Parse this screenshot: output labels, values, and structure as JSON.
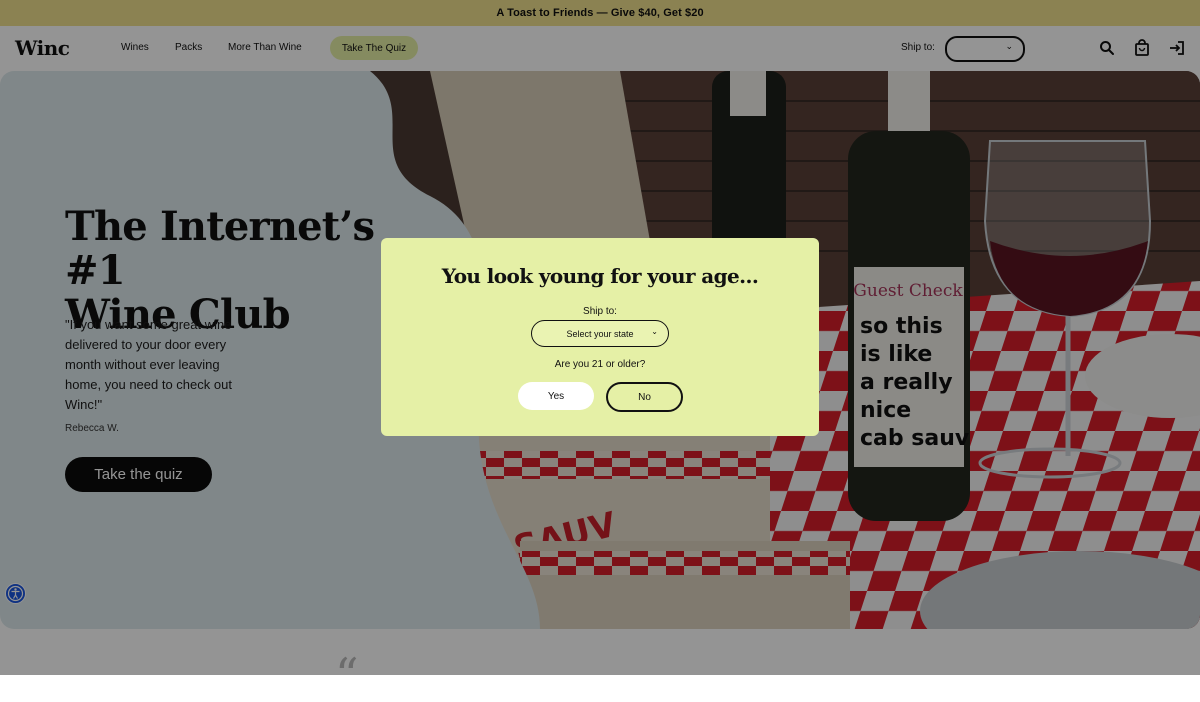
{
  "promo": {
    "text": "A Toast to Friends — Give $40, Get $20"
  },
  "header": {
    "logo": "Winc",
    "nav": [
      "Wines",
      "Packs",
      "More Than Wine"
    ],
    "quiz_label": "Take The Quiz",
    "ship_to_label": "Ship to:",
    "ship_to_value": "",
    "icons": [
      "search-icon",
      "bag-icon",
      "sign-in-icon"
    ]
  },
  "hero": {
    "title_line1": "The Internet’s #1",
    "title_line2": "Wine Club",
    "quote": "\"If you want some great wine delivered to your door every month without ever leaving home, you need to check out Winc!\"",
    "author": "Rebecca W.",
    "cta": "Take the quiz",
    "bottle_label_brand": "Guest Check",
    "bottle_label_text": [
      "so this",
      "is like",
      "a really",
      "nice",
      "cab sauv"
    ],
    "box_text": "-SAUV"
  },
  "modal": {
    "title": "You look young for your age...",
    "ship_label": "Ship to:",
    "state_placeholder": "Select your state",
    "age_question": "Are you 21 or older?",
    "yes": "Yes",
    "no": "No"
  },
  "colors": {
    "promo_bg": "#f0e08e",
    "quiz_pill_bg": "#e6f0a6",
    "modal_bg": "#e5f0a6",
    "hero_panel": "#dde9ec",
    "cta_bg": "#0c0c0c",
    "a11y_blue": "#1a56e0"
  }
}
